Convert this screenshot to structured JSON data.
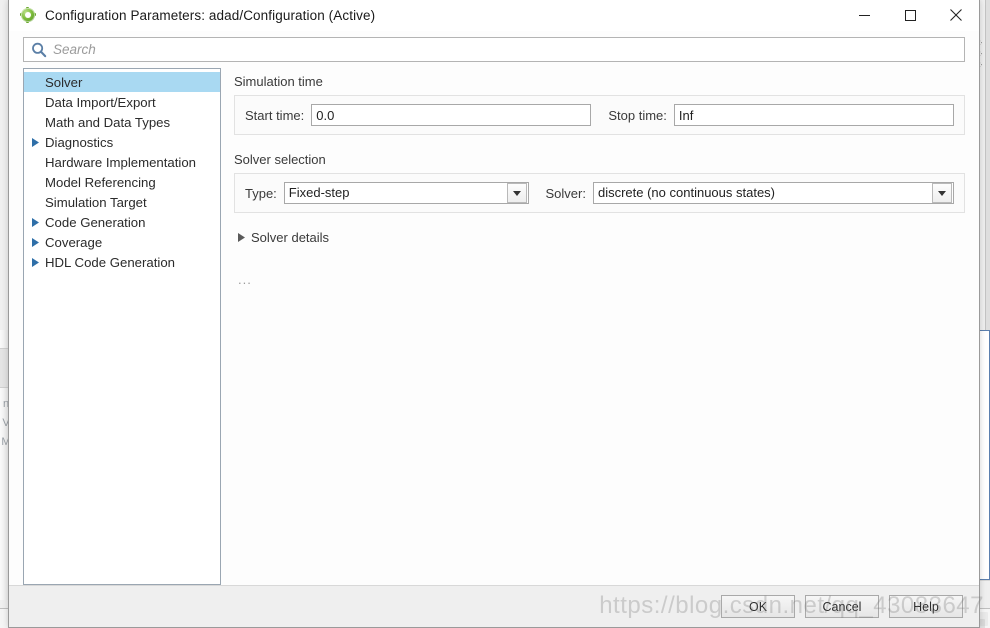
{
  "window": {
    "title": "Configuration Parameters: adad/Configuration (Active)",
    "app_icon": "simulink-gear-icon",
    "minimize_label": "Minimize",
    "maximize_label": "Maximize",
    "close_label": "Close"
  },
  "search": {
    "icon": "search-icon",
    "placeholder": "Search",
    "value": ""
  },
  "tree": {
    "selected": "Solver",
    "items": [
      {
        "label": "Solver",
        "expandable": false,
        "selected": true
      },
      {
        "label": "Data Import/Export",
        "expandable": false,
        "selected": false
      },
      {
        "label": "Math and Data Types",
        "expandable": false,
        "selected": false
      },
      {
        "label": "Diagnostics",
        "expandable": true,
        "selected": false
      },
      {
        "label": "Hardware Implementation",
        "expandable": false,
        "selected": false
      },
      {
        "label": "Model Referencing",
        "expandable": false,
        "selected": false
      },
      {
        "label": "Simulation Target",
        "expandable": false,
        "selected": false
      },
      {
        "label": "Code Generation",
        "expandable": true,
        "selected": false
      },
      {
        "label": "Coverage",
        "expandable": true,
        "selected": false
      },
      {
        "label": "HDL Code Generation",
        "expandable": true,
        "selected": false
      }
    ]
  },
  "content": {
    "simulation_time": {
      "title": "Simulation time",
      "start_label": "Start time:",
      "start_value": "0.0",
      "stop_label": "Stop time:",
      "stop_value": "Inf"
    },
    "solver_selection": {
      "title": "Solver selection",
      "type_label": "Type:",
      "type_value": "Fixed-step",
      "solver_label": "Solver:",
      "solver_value": "discrete (no continuous states)"
    },
    "solver_details": {
      "label": "Solver details",
      "expanded": false
    },
    "ellipsis": "..."
  },
  "footer": {
    "ok_label": "OK",
    "cancel_label": "Cancel",
    "help_label": "Help"
  },
  "watermark": {
    "text": "https://blog.csdn.net/qq_43083647"
  },
  "background": {
    "vertical_text": "n V M",
    "colors": {
      "selection_blue": "#a9d9f2",
      "tree_border": "#9aa6b2",
      "search_icon": "#5b7fa6"
    }
  }
}
